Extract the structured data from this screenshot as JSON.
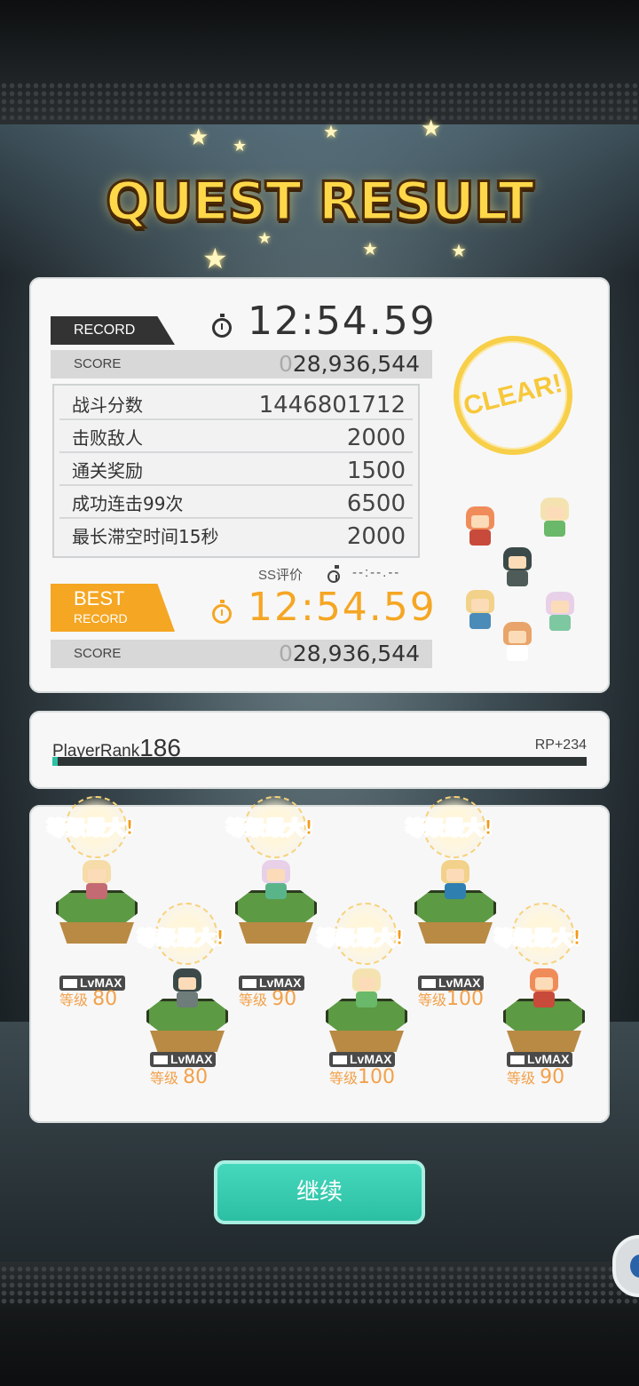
{
  "title": "QUEST RESULT",
  "record": {
    "tag": "RECORD",
    "time": "12:54.59",
    "score_label": "SCORE",
    "score_lead": "0",
    "score_value": "28,936,544"
  },
  "bonuses": [
    {
      "name": "战斗分数",
      "value": "1446801712"
    },
    {
      "name": "击败敌人",
      "value": "2000"
    },
    {
      "name": "通关奖励",
      "value": "1500"
    },
    {
      "name": "成功连击99次",
      "value": "6500"
    },
    {
      "name": "最长滞空时间15秒",
      "value": "2000"
    }
  ],
  "ss_rating": {
    "label": "SS评价",
    "time": "--:--.--"
  },
  "best": {
    "tag_line1": "BEST",
    "tag_line2": "RECORD",
    "time": "12:54.59",
    "score_label": "SCORE",
    "score_lead": "0",
    "score_value": "28,936,544"
  },
  "clear_stamp": "CLEAR!",
  "player_rank": {
    "label": "PlayerRank",
    "value": "186",
    "rp": "RP+234",
    "progress": 0.01
  },
  "units": [
    {
      "max_text": "等级最大!",
      "badge": "LvMAX",
      "level_prefix": "等级",
      "level": "80"
    },
    {
      "max_text": "等级最大!",
      "badge": "LvMAX",
      "level_prefix": "等级",
      "level": "80"
    },
    {
      "max_text": "等级最大!",
      "badge": "LvMAX",
      "level_prefix": "等级",
      "level": "90"
    },
    {
      "max_text": "等级最大!",
      "badge": "LvMAX",
      "level_prefix": "等级",
      "level": "100"
    },
    {
      "max_text": "等级最大!",
      "badge": "LvMAX",
      "level_prefix": "等级",
      "level": "100"
    },
    {
      "max_text": "等级最大!",
      "badge": "LvMAX",
      "level_prefix": "等级",
      "level": "90"
    }
  ],
  "continue_label": "继续",
  "colors": {
    "accent": "#2bc2a4",
    "best": "#f5a623",
    "title": "#ffd84a",
    "level": "#f39a1b"
  }
}
